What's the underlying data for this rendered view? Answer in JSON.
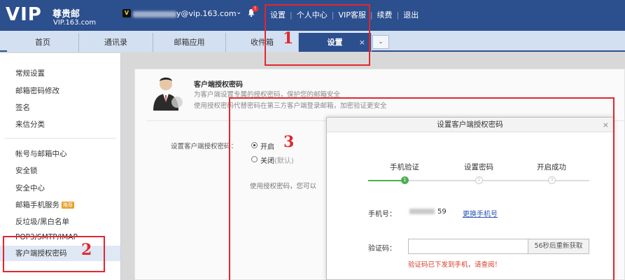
{
  "header": {
    "logo_vip": "VIP",
    "logo_title": "尊贵邮",
    "logo_domain": "VIP.163.com",
    "badge": "V",
    "account_suffix": "y@vip.163.com",
    "notification_count": "!",
    "links": {
      "settings": "设置",
      "personal_center": "个人中心",
      "vip_service": "VIP客服",
      "renew": "续费",
      "logout": "退出"
    }
  },
  "tabs": {
    "home": "首页",
    "contacts": "通讯录",
    "apps": "邮箱应用",
    "inbox": "收件箱",
    "settings": "设置",
    "close": "×",
    "more": "⌄"
  },
  "sidebar": {
    "general": "常规设置",
    "password": "邮箱密码修改",
    "signature": "签名",
    "sender_category": "来信分类",
    "account_center": "帐号与邮箱中心",
    "security_lock": "安全锁",
    "security_center": "安全中心",
    "mobile_service": "邮箱手机服务",
    "mobile_tag": "推荐",
    "antispam": "反垃圾/黑白名单",
    "pop3": "POP3/SMTP/IMAP",
    "client_auth": "客户端授权密码"
  },
  "content": {
    "title": "客户端授权密码",
    "desc1": "为客户端设置专属的授权密码，保护您的邮箱安全",
    "desc2": "使用授权密码代替密码在第三方客户端登录邮箱，加密验证更安全",
    "row_label": "设置客户端授权密码：",
    "opt_on": "开启",
    "opt_off": "关闭",
    "opt_off_note": "(默认)",
    "hint": "使用授权密码，您可以"
  },
  "dialog": {
    "title": "设置客户端授权密码",
    "close": "×",
    "steps": [
      "手机验证",
      "设置密码",
      "开启成功"
    ],
    "step_numbers": [
      "1",
      "2",
      "3"
    ],
    "phone_label": "手机号：",
    "phone_suffix": "59",
    "change_phone": "更换手机号",
    "code_label": "验证码：",
    "code_value": "",
    "resend_button": "56秒后重新获取",
    "sent_msg": "验证码已下发到手机，请查阅！"
  },
  "annotations": {
    "n1": "1",
    "n2": "2",
    "n3": "3",
    "color": "#e3262f"
  }
}
